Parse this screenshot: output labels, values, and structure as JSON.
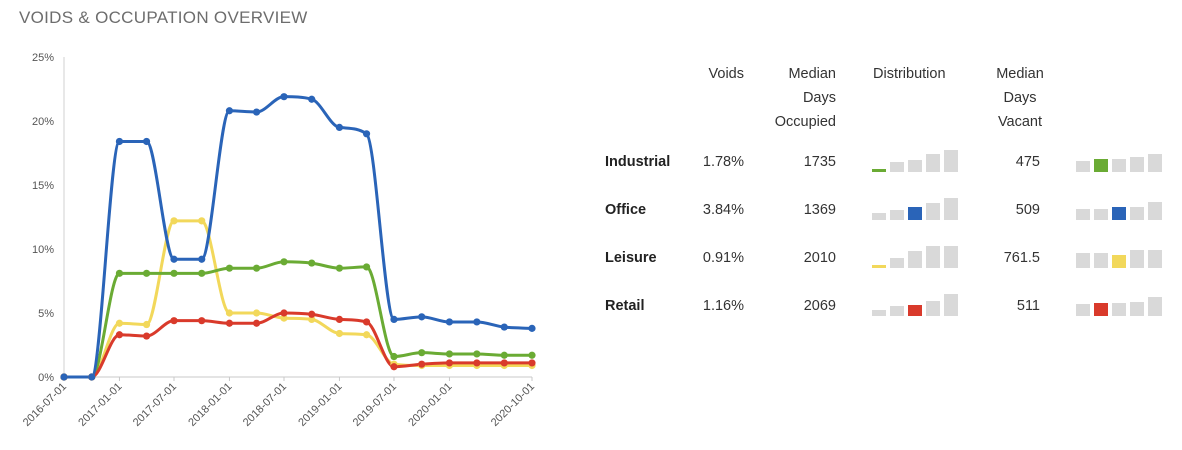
{
  "header": {
    "title": "VOIDS & OCCUPATION OVERVIEW"
  },
  "chart_data": {
    "type": "line",
    "title": "",
    "xlabel": "",
    "ylabel": "",
    "ylim": [
      0,
      25
    ],
    "y_ticks": [
      "0%",
      "5%",
      "10%",
      "15%",
      "20%",
      "25%"
    ],
    "x_ticks": [
      "2016-07-01",
      "2017-01-01",
      "2017-07-01",
      "2018-01-01",
      "2018-07-01",
      "2019-01-01",
      "2019-07-01",
      "2020-01-01",
      "2020-10-01"
    ],
    "x": [
      "2016-07-01",
      "2016-10-01",
      "2017-01-01",
      "2017-04-01",
      "2017-07-01",
      "2017-10-01",
      "2018-01-01",
      "2018-04-01",
      "2018-07-01",
      "2018-10-01",
      "2019-01-01",
      "2019-04-01",
      "2019-07-01",
      "2019-10-01",
      "2020-01-01",
      "2020-04-01",
      "2020-07-01",
      "2020-10-01"
    ],
    "grid": false,
    "legend": "none",
    "series": [
      {
        "color": "#2a64b8",
        "values": [
          0,
          0,
          18.4,
          18.4,
          9.2,
          9.2,
          20.8,
          20.7,
          21.9,
          21.7,
          19.5,
          19.0,
          4.5,
          4.7,
          4.3,
          4.3,
          3.9,
          3.8
        ]
      },
      {
        "color": "#f2d85b",
        "values": [
          0,
          0,
          4.2,
          4.1,
          12.2,
          12.2,
          5.0,
          5.0,
          4.6,
          4.5,
          3.4,
          3.3,
          1.0,
          0.9,
          0.9,
          0.9,
          0.9,
          0.9
        ]
      },
      {
        "color": "#6aab34",
        "values": [
          0,
          0,
          8.1,
          8.1,
          8.1,
          8.1,
          8.5,
          8.5,
          9.0,
          8.9,
          8.5,
          8.6,
          1.6,
          1.9,
          1.8,
          1.8,
          1.7,
          1.7
        ]
      },
      {
        "color": "#d93a2b",
        "values": [
          0,
          0,
          3.3,
          3.2,
          4.4,
          4.4,
          4.2,
          4.2,
          5.0,
          4.9,
          4.5,
          4.3,
          0.8,
          1.0,
          1.1,
          1.1,
          1.1,
          1.1
        ]
      }
    ]
  },
  "table": {
    "headers": {
      "voids": "Voids",
      "median_occupied": [
        "Median",
        "Days",
        "Occupied"
      ],
      "distribution": "Distribution",
      "median_vacant": [
        "Median",
        "Days",
        "Vacant"
      ]
    },
    "rows": [
      {
        "name": "Industrial",
        "voids": "1.78%",
        "occupied": "1735",
        "vacant": "475",
        "color": "#6aab34",
        "distribution": {
          "levels": [
            0.15,
            0.45,
            0.55,
            0.8,
            1.0
          ],
          "highlight": 0
        },
        "vacant_distribution": {
          "levels": [
            0.5,
            0.6,
            0.6,
            0.7,
            0.8
          ],
          "highlight": 1
        }
      },
      {
        "name": "Office",
        "voids": "3.84%",
        "occupied": "1369",
        "vacant": "509",
        "color": "#2a64b8",
        "distribution": {
          "levels": [
            0.3,
            0.45,
            0.6,
            0.75,
            1.0
          ],
          "highlight": 2
        },
        "vacant_distribution": {
          "levels": [
            0.5,
            0.5,
            0.6,
            0.6,
            0.8
          ],
          "highlight": 2
        }
      },
      {
        "name": "Leisure",
        "voids": "0.91%",
        "occupied": "2010",
        "vacant": "761.5",
        "color": "#f2d85b",
        "distribution": {
          "levels": [
            0.15,
            0.45,
            0.75,
            1.0,
            1.0
          ],
          "highlight": 0
        },
        "vacant_distribution": {
          "levels": [
            0.7,
            0.7,
            0.8,
            0.8,
            0.8
          ],
          "highlight": 2
        }
      },
      {
        "name": "Retail",
        "voids": "1.16%",
        "occupied": "2069",
        "vacant": "511",
        "color": "#d93a2b",
        "distribution": {
          "levels": [
            0.25,
            0.45,
            0.5,
            0.7,
            1.0
          ],
          "highlight": 2
        },
        "vacant_distribution": {
          "levels": [
            0.55,
            0.6,
            0.6,
            0.65,
            0.85
          ],
          "highlight": 1
        }
      }
    ]
  }
}
